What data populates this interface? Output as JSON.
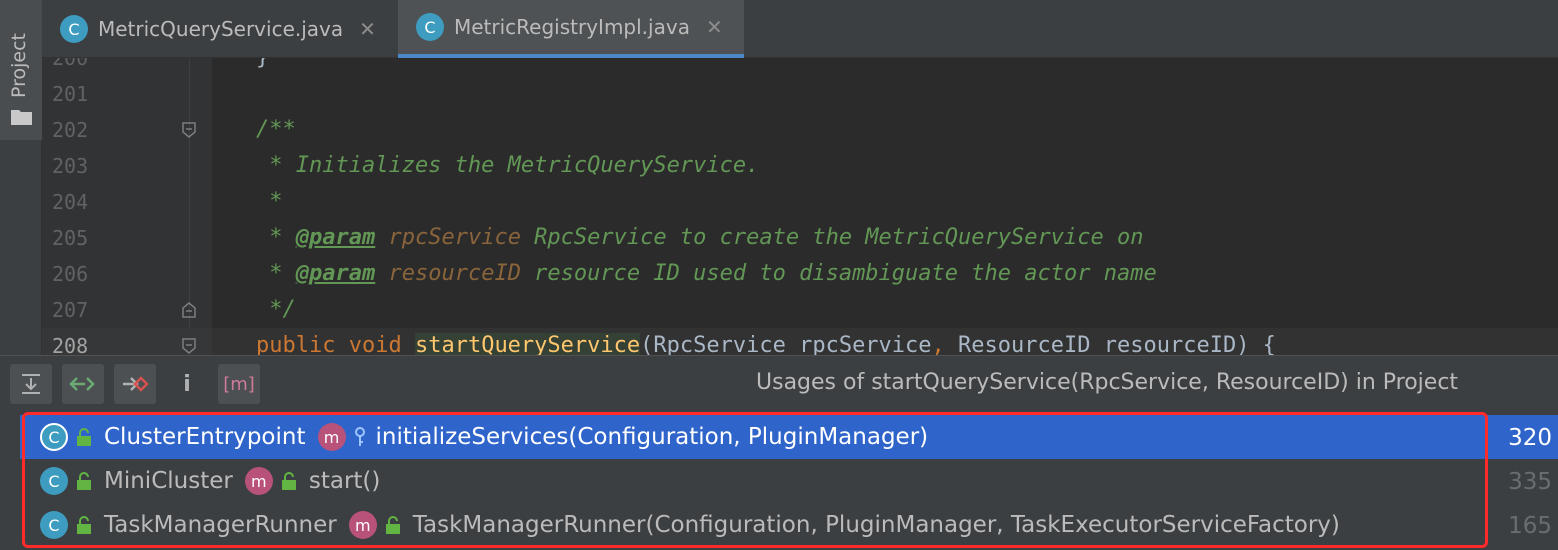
{
  "sidebar": {
    "project_label": "Project",
    "folder_icon": "folder-icon"
  },
  "tabs": [
    {
      "label": "MetricQueryService.java",
      "icon": "C",
      "close": "✕",
      "active": false
    },
    {
      "label": "MetricRegistryImpl.java",
      "icon": "C",
      "close": "✕",
      "active": true
    }
  ],
  "editor": {
    "lines": [
      {
        "num": "200",
        "text": "}"
      },
      {
        "num": "201",
        "text": ""
      },
      {
        "num": "202",
        "text": "/**"
      },
      {
        "num": "203",
        "text": " * Initializes the MetricQueryService."
      },
      {
        "num": "204",
        "text": " *"
      },
      {
        "num": "205",
        "tag": "@param",
        "param": "rpcService",
        "rest": " RpcService to create the MetricQueryService on"
      },
      {
        "num": "206",
        "tag": "@param",
        "param": "resourceID",
        "rest": " resource ID used to disambiguate the actor name"
      },
      {
        "num": "207",
        "text": " */"
      },
      {
        "num": "208",
        "kw1": "public",
        "kw2": "void",
        "method": "startQueryService",
        "args_open": "(RpcService rpcService",
        "comma": ",",
        "args_rest": " ResourceID resourceID) {"
      }
    ]
  },
  "usages": {
    "title": "Usages of startQueryService(RpcService, ResourceID) in Project",
    "toolbar": [
      {
        "name": "collapse-all-icon",
        "glyph": "⤓"
      },
      {
        "name": "previous-occurrence-icon",
        "glyph": "⇠"
      },
      {
        "name": "next-occurrence-icon",
        "glyph": "⇢"
      },
      {
        "name": "info-icon",
        "glyph": "i"
      },
      {
        "name": "method-filter-icon",
        "glyph": "[m]"
      }
    ],
    "rows": [
      {
        "icon": "C",
        "class_name": "ClusterEntrypoint",
        "method_icon": "m",
        "method": "initializeServices(Configuration, PluginManager)",
        "line": "320",
        "selected": true
      },
      {
        "icon": "C",
        "class_name": "MiniCluster",
        "method_icon": "m",
        "method": "start()",
        "line": "335",
        "selected": false
      },
      {
        "icon": "C",
        "class_name": "TaskManagerRunner",
        "method_icon": "m",
        "method": "TaskManagerRunner(Configuration, PluginManager, TaskExecutorServiceFactory)",
        "line": "165",
        "selected": false
      }
    ]
  },
  "colors": {
    "accent": "#2f65ca",
    "highlight_frame": "#ff2a2a"
  }
}
